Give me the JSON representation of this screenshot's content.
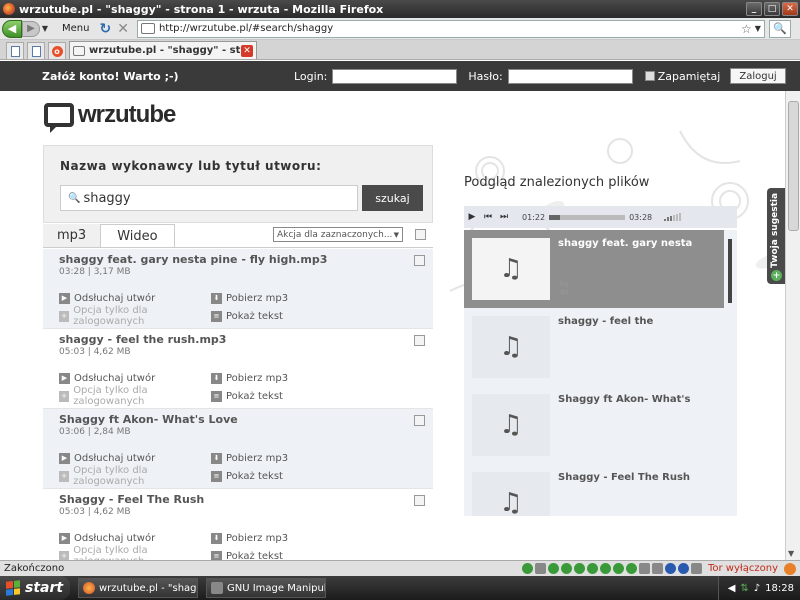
{
  "window": {
    "title": "wrzutube.pl - \"shaggy\" - strona 1 - wrzuta - Mozilla Firefox"
  },
  "nav": {
    "menu_label": "Menu",
    "url": "http://wrzutube.pl/#search/shaggy"
  },
  "tabs": {
    "active_label": "wrzutube.pl - \"shaggy\" - strona ..."
  },
  "site": {
    "promo": "Załóż konto! Warto ;-)",
    "login_label": "Login:",
    "password_label": "Hasło:",
    "remember_label": "Zapamiętaj",
    "login_button": "Zaloguj",
    "logo_text": "wrzutube"
  },
  "search": {
    "heading": "Nazwa wykonawcy lub tytuł utworu:",
    "query": "shaggy",
    "button": "szukaj"
  },
  "result_tabs": {
    "mp3": "mp3",
    "video": "Wideo",
    "action_select": "Akcja dla zaznaczonych..."
  },
  "actions": {
    "listen": "Odsłuchaj utwór",
    "download": "Pobierz mp3",
    "logged_only": "Opcja tylko dla zalogowanych",
    "lyrics": "Pokaż tekst"
  },
  "results": [
    {
      "name": "shaggy feat. gary nesta pine - fly high.mp3",
      "meta": "03:28 | 3,17 MB"
    },
    {
      "name": "shaggy - feel the rush.mp3",
      "meta": "05:03 | 4,62 MB"
    },
    {
      "name": "Shaggy ft Akon- What's Love",
      "meta": "03:06 | 2,84 MB"
    },
    {
      "name": "Shaggy - Feel The Rush",
      "meta": "05:03 | 4,62 MB"
    }
  ],
  "preview": {
    "title": "Podgląd znalezionych plików",
    "time_current": "01:22",
    "time_total": "03:28",
    "progress_fraction": 0.14,
    "items": [
      {
        "name": "shaggy feat. gary nesta",
        "by": "by",
        "by2": "do"
      },
      {
        "name": "shaggy - feel the"
      },
      {
        "name": "Shaggy ft Akon- What's"
      },
      {
        "name": "Shaggy - Feel The Rush"
      }
    ]
  },
  "sugestia": "Twoja sugestia",
  "statusbar": {
    "status": "Zakończono",
    "tor": "Tor wyłączony"
  },
  "taskbar": {
    "start": "start",
    "task1": "wrzutube.pl - \"shagg...",
    "task2": "GNU Image Manipulat...",
    "clock": "18:28"
  }
}
